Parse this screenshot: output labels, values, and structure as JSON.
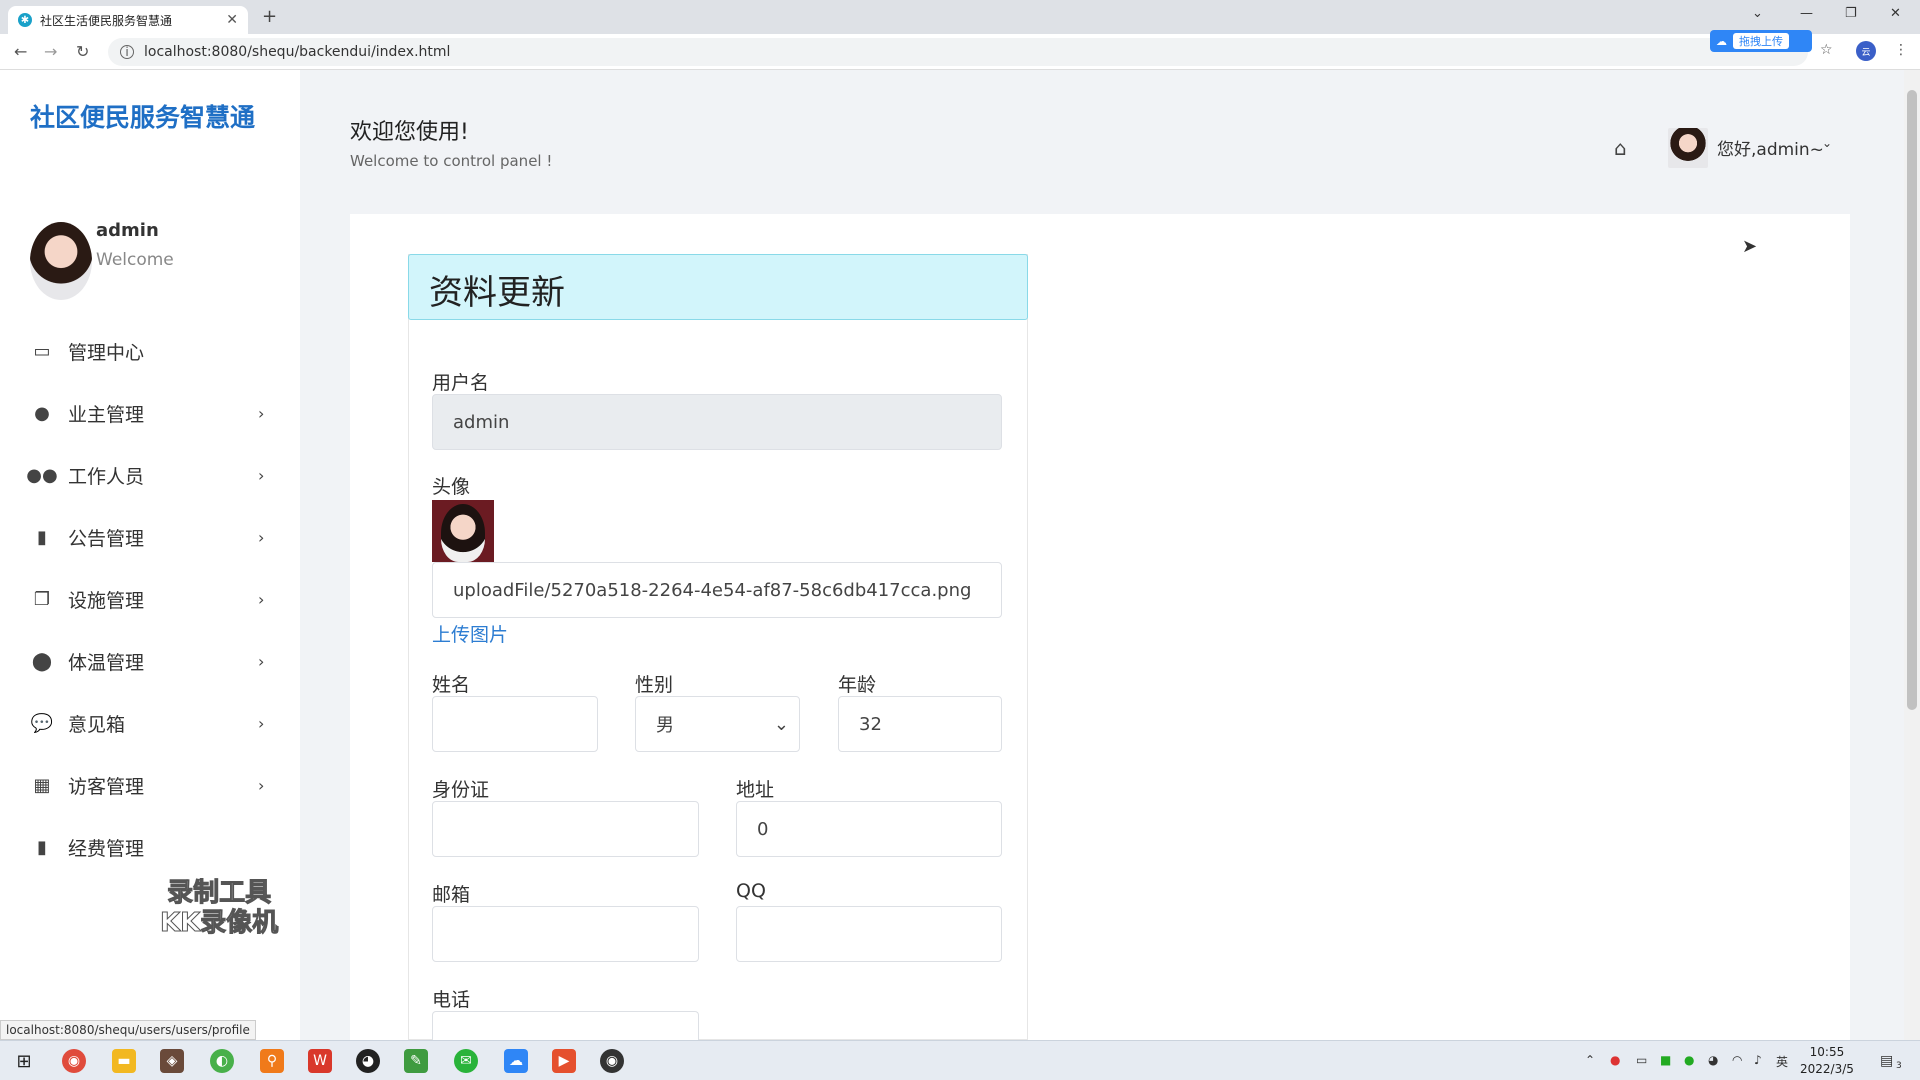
{
  "browser": {
    "tab_title": "社区生活便民服务智慧通",
    "url": "localhost:8080/shequ/backendui/index.html",
    "upload_badge": "拖拽上传",
    "status_url": "localhost:8080/shequ/users/users/profile"
  },
  "sidebar": {
    "brand": "社区便民服务智慧通",
    "user_name": "admin",
    "user_welcome": "Welcome",
    "items": [
      {
        "label": "管理中心",
        "icon": "monitor-icon",
        "has_chevron": false
      },
      {
        "label": "业主管理",
        "icon": "user-icon",
        "has_chevron": true
      },
      {
        "label": "工作人员",
        "icon": "users-icon",
        "has_chevron": true
      },
      {
        "label": "公告管理",
        "icon": "file-icon",
        "has_chevron": true
      },
      {
        "label": "设施管理",
        "icon": "copy-icon",
        "has_chevron": true
      },
      {
        "label": "体温管理",
        "icon": "circle-icon",
        "has_chevron": true
      },
      {
        "label": "意见箱",
        "icon": "comment-icon",
        "has_chevron": true
      },
      {
        "label": "访客管理",
        "icon": "grid-icon",
        "has_chevron": true
      },
      {
        "label": "经费管理",
        "icon": "file-icon",
        "has_chevron": false
      }
    ],
    "watermark_line1": "录制工具",
    "watermark_line2": "KK录像机"
  },
  "header": {
    "title": "欢迎您使用!",
    "subtitle": "Welcome to control panel !",
    "user_greeting": "您好,admin~"
  },
  "form": {
    "heading": "资料更新",
    "username_label": "用户名",
    "username_value": "admin",
    "avatar_label": "头像",
    "avatar_path": "uploadFile/5270a518-2264-4e54-af87-58c6db417cca.png",
    "upload_link": "上传图片",
    "name_label": "姓名",
    "name_value": "",
    "gender_label": "性别",
    "gender_value": "男",
    "age_label": "年龄",
    "age_value": "32",
    "idcard_label": "身份证",
    "idcard_value": "",
    "address_label": "地址",
    "address_value": "0",
    "email_label": "邮箱",
    "email_value": "",
    "qq_label": "QQ",
    "qq_value": "",
    "phone_label": "电话"
  },
  "taskbar": {
    "time": "10:55",
    "date": "2022/3/5",
    "ime": "英",
    "notification_count": "3"
  }
}
